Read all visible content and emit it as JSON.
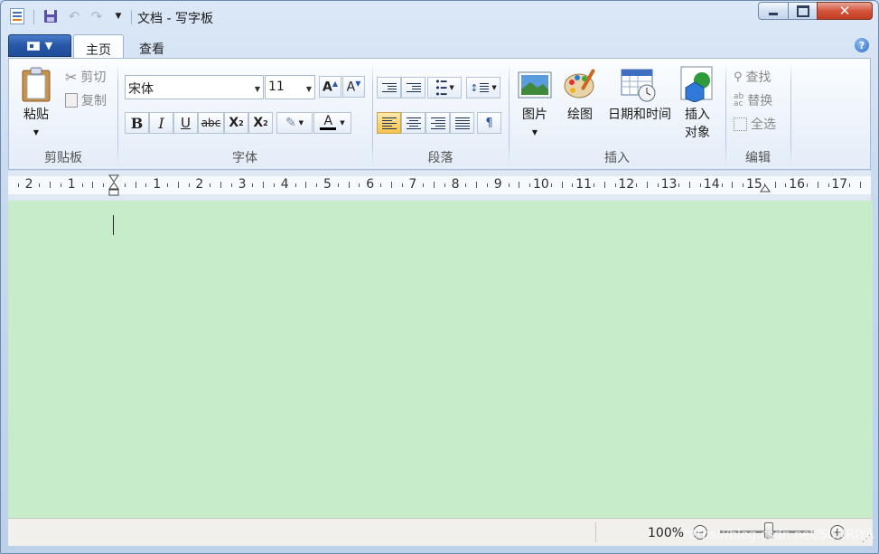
{
  "window": {
    "title": "文档 - 写字板"
  },
  "quick_access": {
    "icons": [
      "save-icon",
      "undo-icon",
      "redo-icon",
      "customize-dropdown-icon"
    ]
  },
  "tabs": [
    {
      "label": "主页",
      "active": true
    },
    {
      "label": "查看",
      "active": false
    }
  ],
  "ribbon": {
    "clipboard": {
      "group_label": "剪贴板",
      "paste": "粘贴",
      "cut": "剪切",
      "copy": "复制"
    },
    "font": {
      "group_label": "字体",
      "font_family": "宋体",
      "font_size": "11",
      "bold": "B",
      "italic": "I",
      "underline": "U",
      "strikethrough": "abc",
      "subscript": "X",
      "superscript": "X",
      "text_color": "A"
    },
    "paragraph": {
      "group_label": "段落"
    },
    "insert": {
      "group_label": "插入",
      "picture": "图片",
      "paint": "绘图",
      "datetime": "日期和时间",
      "object_line1": "插入",
      "object_line2": "对象"
    },
    "editing": {
      "group_label": "编辑",
      "find": "查找",
      "replace": "替换",
      "select_all": "全选"
    }
  },
  "ruler": {
    "labels": [
      "2",
      "1",
      "1",
      "2",
      "3",
      "4",
      "5",
      "6",
      "7",
      "8",
      "9",
      "10",
      "11",
      "12",
      "13",
      "14",
      "15",
      "16",
      "17"
    ]
  },
  "document": {
    "text": "",
    "background_color": "#c7ecca"
  },
  "status": {
    "zoom": "100%",
    "watermark": "https://blog.csdn.net/SUNRIYA"
  },
  "colors": {
    "accent": "#2757a6",
    "highlight": "#fbd676",
    "close": "#c13d22"
  }
}
